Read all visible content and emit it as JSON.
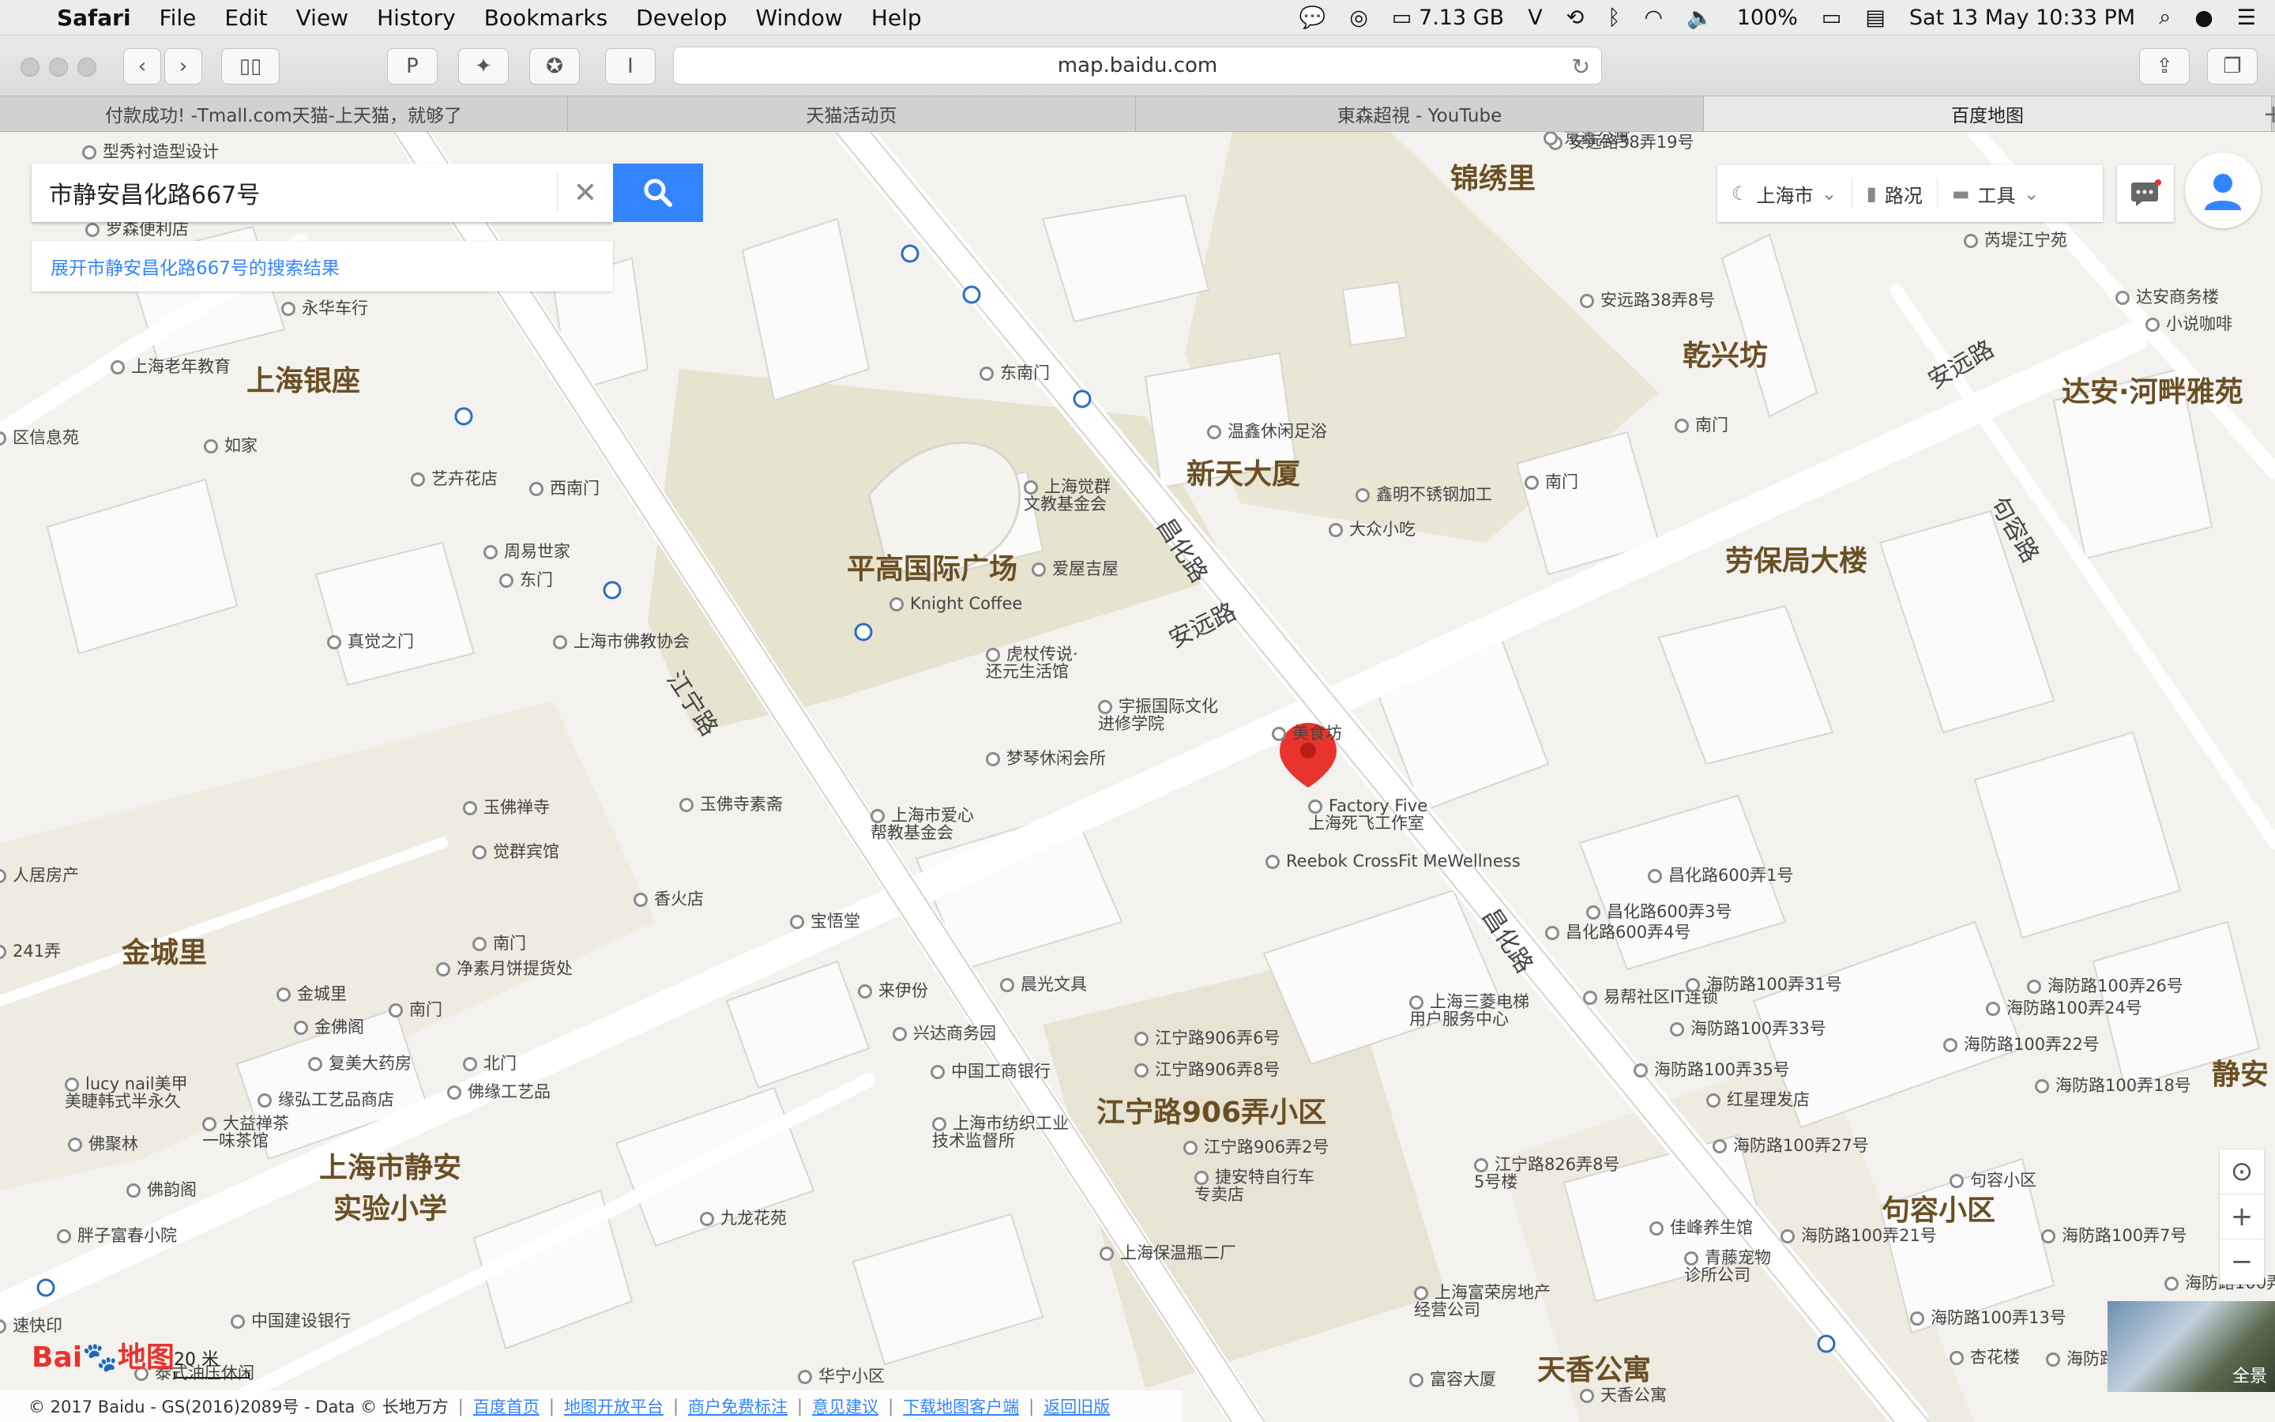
{
  "menubar": {
    "app_name": "Safari",
    "menus": [
      "File",
      "Edit",
      "View",
      "History",
      "Bookmarks",
      "Develop",
      "Window",
      "Help"
    ],
    "storage": "7.13 GB",
    "battery": "100%",
    "datetime": "Sat 13 May  10:33 PM"
  },
  "toolbar": {
    "url": "map.baidu.com"
  },
  "tabs": [
    {
      "label": "付款成功! -Tmall.com天猫-上天猫，就够了"
    },
    {
      "label": "天猫活动页"
    },
    {
      "label": "東森超視 - YouTube"
    },
    {
      "label": "百度地图"
    }
  ],
  "search": {
    "value": "市静安昌化路667号",
    "expand_text": "展开市静安昌化路667号的搜索结果"
  },
  "controls": {
    "city": "上海市",
    "traffic": "路况",
    "tools": "工具"
  },
  "map": {
    "areas": [
      {
        "text": "上海银座"
      },
      {
        "text": "平高国际广场"
      },
      {
        "text": "新天大厦"
      },
      {
        "text": "锦绣里"
      },
      {
        "text": "乾兴坊"
      },
      {
        "text": "达安·河畔雅苑"
      },
      {
        "text": "劳保局大楼"
      },
      {
        "text": "金城里"
      },
      {
        "text": "上海市静安\n实验小学"
      },
      {
        "text": "江宁路906弄小区"
      },
      {
        "text": "句容小区"
      },
      {
        "text": "天香公寓"
      },
      {
        "text": "静安"
      }
    ],
    "roads": [
      {
        "text": "江宁路"
      },
      {
        "text": "昌化路"
      },
      {
        "text": "安远路"
      },
      {
        "text": "昌化路"
      },
      {
        "text": "安远路"
      },
      {
        "text": "句容路"
      }
    ],
    "pois": [
      {
        "text": "型秀衬造型设计"
      },
      {
        "text": "罗森便利店"
      },
      {
        "text": "永华车行"
      },
      {
        "text": "上海老年教育"
      },
      {
        "text": "如家"
      },
      {
        "text": "艺卉花店"
      },
      {
        "text": "西南门"
      },
      {
        "text": "周易世家"
      },
      {
        "text": "东门"
      },
      {
        "text": "真觉之门"
      },
      {
        "text": "上海市佛教协会"
      },
      {
        "text": "东南门"
      },
      {
        "text": "上海觉群\n文教基金会"
      },
      {
        "text": "爱屋吉屋"
      },
      {
        "text": "Knight Coffee"
      },
      {
        "text": "虎杖传说·\n还元生活馆"
      },
      {
        "text": "温鑫休闲足浴"
      },
      {
        "text": "鑫明不锈钢加工"
      },
      {
        "text": "大众小吃"
      },
      {
        "text": "南门"
      },
      {
        "text": "宇振国际文化\n进修学院"
      },
      {
        "text": "梦琴休闲会所"
      },
      {
        "text": "美食坊"
      },
      {
        "text": "Factory Five\n上海死飞工作室"
      },
      {
        "text": "Reebok CrossFit MeWellness"
      },
      {
        "text": "玉佛禅寺"
      },
      {
        "text": "玉佛寺素斋"
      },
      {
        "text": "觉群宾馆"
      },
      {
        "text": "上海市爱心\n帮教基金会"
      },
      {
        "text": "香火店"
      },
      {
        "text": "宝悟堂"
      },
      {
        "text": "南门"
      },
      {
        "text": "净素月饼提货处"
      },
      {
        "text": "金城里"
      },
      {
        "text": "南门"
      },
      {
        "text": "金佛阁"
      },
      {
        "text": "来伊份"
      },
      {
        "text": "晨光文具"
      },
      {
        "text": "兴达商务园"
      },
      {
        "text": "中国工商银行"
      },
      {
        "text": "复美大药房"
      },
      {
        "text": "北门"
      },
      {
        "text": "缘弘工艺品商店"
      },
      {
        "text": "佛缘工艺品"
      },
      {
        "text": "lucy nail美甲\n美睫韩式半永久"
      },
      {
        "text": "大益禅茶\n一味茶馆"
      },
      {
        "text": "佛聚林"
      },
      {
        "text": "佛韵阁"
      },
      {
        "text": "上海市纺织工业\n技术监督所"
      },
      {
        "text": "胖子富春小院"
      },
      {
        "text": "九龙花苑"
      },
      {
        "text": "捷安特自行车\n专卖店"
      },
      {
        "text": "上海保温瓶二厂"
      },
      {
        "text": "中国建设银行"
      },
      {
        "text": "上海三菱电梯\n用户服务中心"
      },
      {
        "text": "易帮社区IT连锁"
      },
      {
        "text": "红星理发店"
      },
      {
        "text": "佳峰养生馆"
      },
      {
        "text": "青藤宠物\n诊所公司"
      },
      {
        "text": "上海富荣房地产\n经营公司"
      },
      {
        "text": "富容大厦"
      },
      {
        "text": "天香公寓"
      },
      {
        "text": "杏花楼"
      },
      {
        "text": "句容小区"
      },
      {
        "text": "芮堤江宁苑"
      },
      {
        "text": "南门"
      },
      {
        "text": "达安商务楼"
      },
      {
        "text": "小说咖啡"
      },
      {
        "text": "江宁路906弄6号"
      },
      {
        "text": "江宁路906弄8号"
      },
      {
        "text": "江宁路906弄2号"
      },
      {
        "text": "昌化路600弄1号"
      },
      {
        "text": "昌化路600弄3号"
      },
      {
        "text": "昌化路600弄4号"
      },
      {
        "text": "海防路100弄31号"
      },
      {
        "text": "海防路100弄33号"
      },
      {
        "text": "海防路100弄35号"
      },
      {
        "text": "海防路100弄27号"
      },
      {
        "text": "海防路100弄21号"
      },
      {
        "text": "海防路100弄13号"
      },
      {
        "text": "海防路100弄26号"
      },
      {
        "text": "海防路100弄24号"
      },
      {
        "text": "海防路100弄22号"
      },
      {
        "text": "海防路100弄18号"
      },
      {
        "text": "海防路100弄7号"
      },
      {
        "text": "海防路100弄3号"
      },
      {
        "text": "海防路100弄"
      },
      {
        "text": "江宁路826弄8号\n5号楼"
      },
      {
        "text": "安远路38弄19号"
      },
      {
        "text": "安远路38弄8号"
      },
      {
        "text": "京鑫公寓"
      },
      {
        "text": "区信息苑"
      },
      {
        "text": "人居房产"
      },
      {
        "text": "241弄"
      },
      {
        "text": "速快印"
      },
      {
        "text": "泰式油压休闲"
      },
      {
        "text": "华宁小区"
      }
    ]
  },
  "scale": "20 米",
  "logo": {
    "text": "Baidu地图"
  },
  "pano_label": "全景",
  "footer": {
    "copyright": "© 2017 Baidu - GS(2016)2089号 - Data © 长地万方",
    "links": [
      "百度首页",
      "地图开放平台",
      "商户免费标注",
      "意见建议",
      "下载地图客户端",
      "返回旧版"
    ]
  },
  "colors": {
    "accent": "#3385ff",
    "marker": "#e8342c",
    "road": "#ffffff",
    "block": "#e8e6e1",
    "building": "#fbfbfb"
  }
}
